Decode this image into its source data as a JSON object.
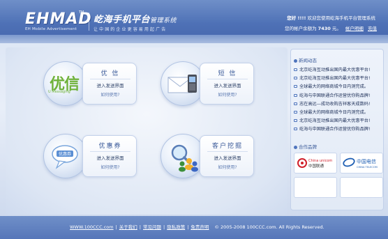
{
  "header": {
    "logo": "EHMAD",
    "logo_tm": "TM",
    "logo_subtitle": "EH Mobile Advertisement",
    "system_title": "屹海手机平台",
    "system_title_suffix": "管理系统",
    "slogan": "让中国的企业更容易用起广告",
    "user_name": "您好 !!!!",
    "welcome": "欢迎您使用屹海手机平台管理系统",
    "balance_prefix": "您的帐户余额为",
    "balance_value": "7430",
    "balance_unit": "元。",
    "account_details_link": "帐户明细",
    "recharge_link": "充值"
  },
  "tiles": {
    "youxin": {
      "title": "优 信",
      "enter": "进入发送界面",
      "howto": "如何使用?",
      "icon_text": "优信",
      "icon_sub": "U Messaging"
    },
    "sms": {
      "title": "短 信",
      "enter": "进入发送界面",
      "howto": "如何使用?"
    },
    "coupon": {
      "title": "优惠券",
      "enter": "进入发送界面",
      "howto": "如何使用?",
      "icon_text": "优惠券"
    },
    "customer": {
      "title": "客户挖掘",
      "enter": "进入发送界面",
      "howto": "如何使用?"
    }
  },
  "sidebar": {
    "news_title": "新闻动态",
    "news": [
      "北京屹海互动推出国内最大优惠平台!",
      "北京屹海互动推出国内最大优惠平台!",
      "全球最大的网络商城今日内测完成。",
      "屹海与中国联通合作运营优你购品牌!",
      "志在高远—成功收购吉祥客天成数码!",
      "全球最大的网络商城今日内测完成。",
      "北京屹海互动推出国内最大优惠平台!",
      "屹海与中国联通合作运营优你购品牌!"
    ],
    "partners_title": "合作品牌",
    "partners": {
      "unicom_cn": "中国联通",
      "unicom_en": "China unicom",
      "telecom_cn": "中国电信",
      "telecom_en": "CHINA TELECOM"
    }
  },
  "footer": {
    "site": "WWW.100CCC.com",
    "about": "关于我们",
    "faq": "常见问题",
    "privacy": "隐私政策",
    "disclaimer": "免责声明",
    "copyright": "© 2005-2008 100CCC.com. All Rights Reserved."
  },
  "colors": {
    "header_blue": "#4e71b6",
    "accent_green": "#6fb23a",
    "text_navy": "#1d2f58"
  }
}
